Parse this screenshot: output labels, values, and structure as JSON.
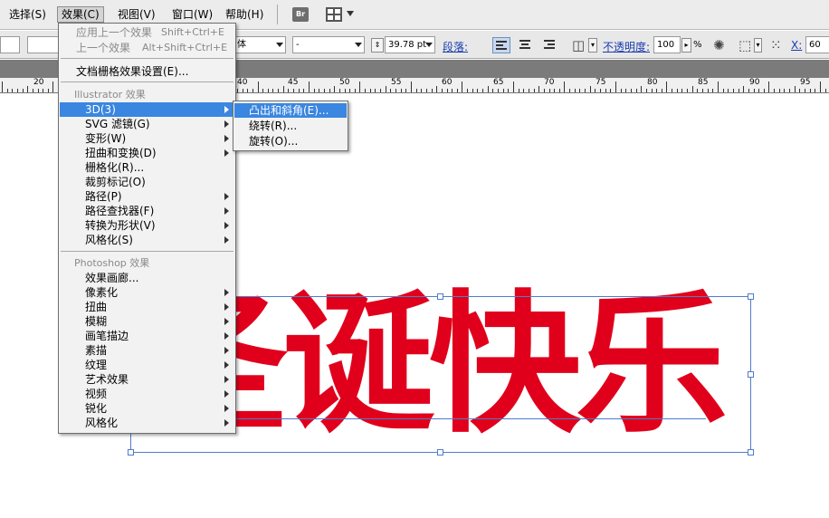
{
  "menubar": {
    "items": [
      {
        "label": "选择(S)"
      },
      {
        "label": "效果(C)"
      },
      {
        "label": "视图(V)"
      },
      {
        "label": "窗口(W)"
      },
      {
        "label": "帮助(H)"
      }
    ],
    "bridge_label": "Br"
  },
  "controlbar": {
    "font_style_value": "体",
    "font_size_value": "-",
    "size_value": "39.78 pt",
    "paragraph_label": "段落:",
    "opacity_label": "不透明度:",
    "opacity_value": "100",
    "opacity_unit": "%",
    "x_label": "X:",
    "x_value": "60"
  },
  "ruler": {
    "labels": [
      "20",
      "40",
      "45",
      "50",
      "55",
      "60",
      "65",
      "70",
      "75",
      "80",
      "85",
      "90",
      "95"
    ]
  },
  "artwork": {
    "text": "圣诞快乐",
    "color": "#e0001c"
  },
  "effect_menu": {
    "recent_items": [
      {
        "label": "应用上一个效果",
        "shortcut": "Shift+Ctrl+E"
      },
      {
        "label": "上一个效果",
        "shortcut": "Alt+Shift+Ctrl+E"
      }
    ],
    "doc_raster_settings": "文档栅格效果设置(E)...",
    "illustrator_header": "Illustrator 效果",
    "illustrator_items": [
      {
        "label": "3D(3)",
        "submenu": true
      },
      {
        "label": "SVG 滤镜(G)",
        "submenu": true
      },
      {
        "label": "变形(W)",
        "submenu": true
      },
      {
        "label": "扭曲和变换(D)",
        "submenu": true
      },
      {
        "label": "栅格化(R)...",
        "submenu": false
      },
      {
        "label": "裁剪标记(O)",
        "submenu": false
      },
      {
        "label": "路径(P)",
        "submenu": true
      },
      {
        "label": "路径查找器(F)",
        "submenu": true
      },
      {
        "label": "转换为形状(V)",
        "submenu": true
      },
      {
        "label": "风格化(S)",
        "submenu": true
      }
    ],
    "photoshop_header": "Photoshop 效果",
    "photoshop_items": [
      {
        "label": "效果画廊...",
        "submenu": false
      },
      {
        "label": "像素化",
        "submenu": true
      },
      {
        "label": "扭曲",
        "submenu": true
      },
      {
        "label": "模糊",
        "submenu": true
      },
      {
        "label": "画笔描边",
        "submenu": true
      },
      {
        "label": "素描",
        "submenu": true
      },
      {
        "label": "纹理",
        "submenu": true
      },
      {
        "label": "艺术效果",
        "submenu": true
      },
      {
        "label": "视频",
        "submenu": true
      },
      {
        "label": "锐化",
        "submenu": true
      },
      {
        "label": "风格化",
        "submenu": true
      }
    ]
  },
  "submenu_3d": {
    "items": [
      {
        "label": "凸出和斜角(E)..."
      },
      {
        "label": "绕转(R)..."
      },
      {
        "label": "旋转(O)..."
      }
    ]
  },
  "colors": {
    "highlight": "#3a86e0",
    "selection": "#4f7dc9"
  }
}
